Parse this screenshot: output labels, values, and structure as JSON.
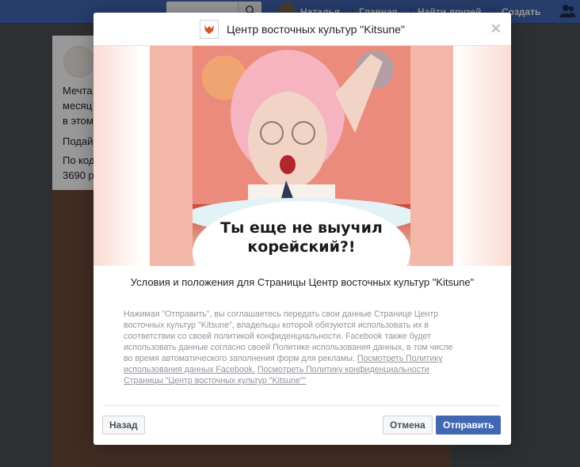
{
  "topbar": {
    "nav": [
      "Наталья",
      "Главная",
      "Найти друзей",
      "Создать"
    ]
  },
  "background_post": {
    "lines": [
      "Мечта",
      "месяц",
      "в этом",
      "Подай",
      "По код",
      "3690 р"
    ]
  },
  "modal": {
    "title": "Центр восточных культур \"Kitsune\"",
    "hero_caption_line1": "Ты еще не выучил",
    "hero_caption_line2": "корейский?!",
    "terms_title": "Условия и положения для Страницы Центр восточных культур \"Kitsune\"",
    "terms_text": "Нажимая \"Отправить\", вы соглашаетесь передать свои данные Странице Центр восточных культур \"Kitsune\", владельцы которой обязуются использовать их в соответствии со своей политикой конфиденциальности. Facebook также будет использовать данные согласно своей Политике использования данных, в том числе во время автоматического заполнения форм для рекламы. ",
    "link_fb_policy": "Посмотреть Политику использования данных Facebook.",
    "link_page_policy": "Посмотреть Политику конфиденциальности Страницы \"Центр восточных культур \"Kitsune\"\"",
    "buttons": {
      "back": "Назад",
      "cancel": "Отмена",
      "submit": "Отправить"
    }
  },
  "colors": {
    "brand": "#4267b2",
    "submit_bg": "#4267b2"
  },
  "icons": [
    "search-icon",
    "friends-icon",
    "close-icon",
    "kitsune-logo"
  ]
}
